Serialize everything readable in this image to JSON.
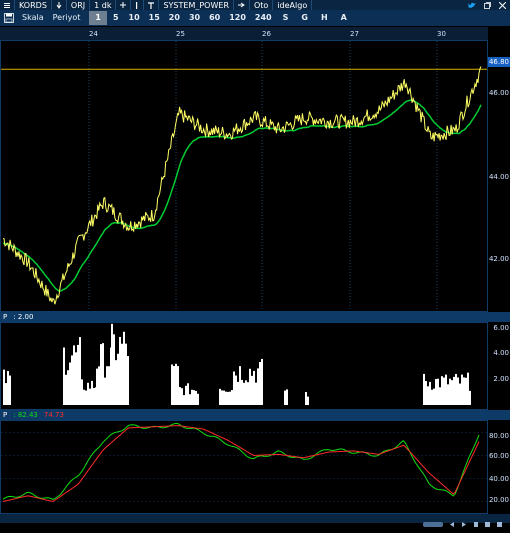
{
  "titlebar": {
    "symbol": "KORDS",
    "interval": "1 dk",
    "period_mode": "ORJ",
    "indicator": "SYSTEM_POWER",
    "auto": "Oto",
    "algo": "ideAlgo",
    "icons": [
      "down-arrow-icon",
      "plus-icon",
      "cursor-icon",
      "text-tool-icon",
      "arrow-right-icon",
      "twitter-icon",
      "window-restore-icon",
      "close-icon"
    ]
  },
  "toolbar": {
    "scale_label": "Skala",
    "period_label": "Periyot",
    "periods": [
      "1",
      "5",
      "10",
      "15",
      "20",
      "30",
      "60",
      "120",
      "240",
      "S",
      "G",
      "H",
      "A"
    ],
    "selected_period": "1"
  },
  "main_chart": {
    "date_labels": [
      "24",
      "25",
      "26",
      "27",
      "30"
    ],
    "price_ticks": [
      "46.00",
      "44.00",
      "42.00"
    ],
    "last_price": "46.80",
    "colors": {
      "price": "#ffff66",
      "signal": "#00cc33",
      "last_line": "#d9b000"
    }
  },
  "power_panel": {
    "label": "P",
    "value": ": 2.00",
    "ticks": [
      "6.00",
      "4.00",
      "2.00"
    ]
  },
  "osc_panel": {
    "label": "P",
    "value_green": ": 82.43",
    "value_red": "74.73",
    "ticks": [
      "80.00",
      "60.00",
      "40.00",
      "20.00"
    ],
    "colors": {
      "green": "#11dd11",
      "red": "#ff2b2b"
    }
  },
  "chart_data": [
    {
      "type": "line",
      "name": "price",
      "x": [
        "24",
        "25",
        "26",
        "27",
        "30"
      ],
      "series": [
        {
          "values": [
            42.6,
            42.0,
            41.0,
            42.5,
            43.5,
            42.9,
            43.2,
            45.7,
            45.3,
            45.2,
            45.6,
            45.3,
            45.6,
            45.5,
            45.5,
            45.8,
            46.5,
            45.1,
            45.3,
            46.8
          ]
        }
      ],
      "ylim": [
        40.8,
        47.5
      ]
    },
    {
      "type": "bar",
      "name": "power",
      "ylim": [
        0,
        6
      ]
    },
    {
      "type": "line",
      "name": "oscillator",
      "series": [
        {
          "values": [
            22,
            27,
            21,
            43,
            73,
            86,
            84,
            87,
            80,
            70,
            57,
            63,
            56,
            66,
            63,
            60,
            72,
            35,
            25,
            79
          ]
        },
        {
          "values": [
            20,
            25,
            20,
            35,
            65,
            84,
            85,
            86,
            83,
            73,
            60,
            61,
            58,
            63,
            64,
            61,
            69,
            45,
            26,
            72
          ]
        }
      ],
      "ylim": [
        10,
        90
      ]
    }
  ]
}
